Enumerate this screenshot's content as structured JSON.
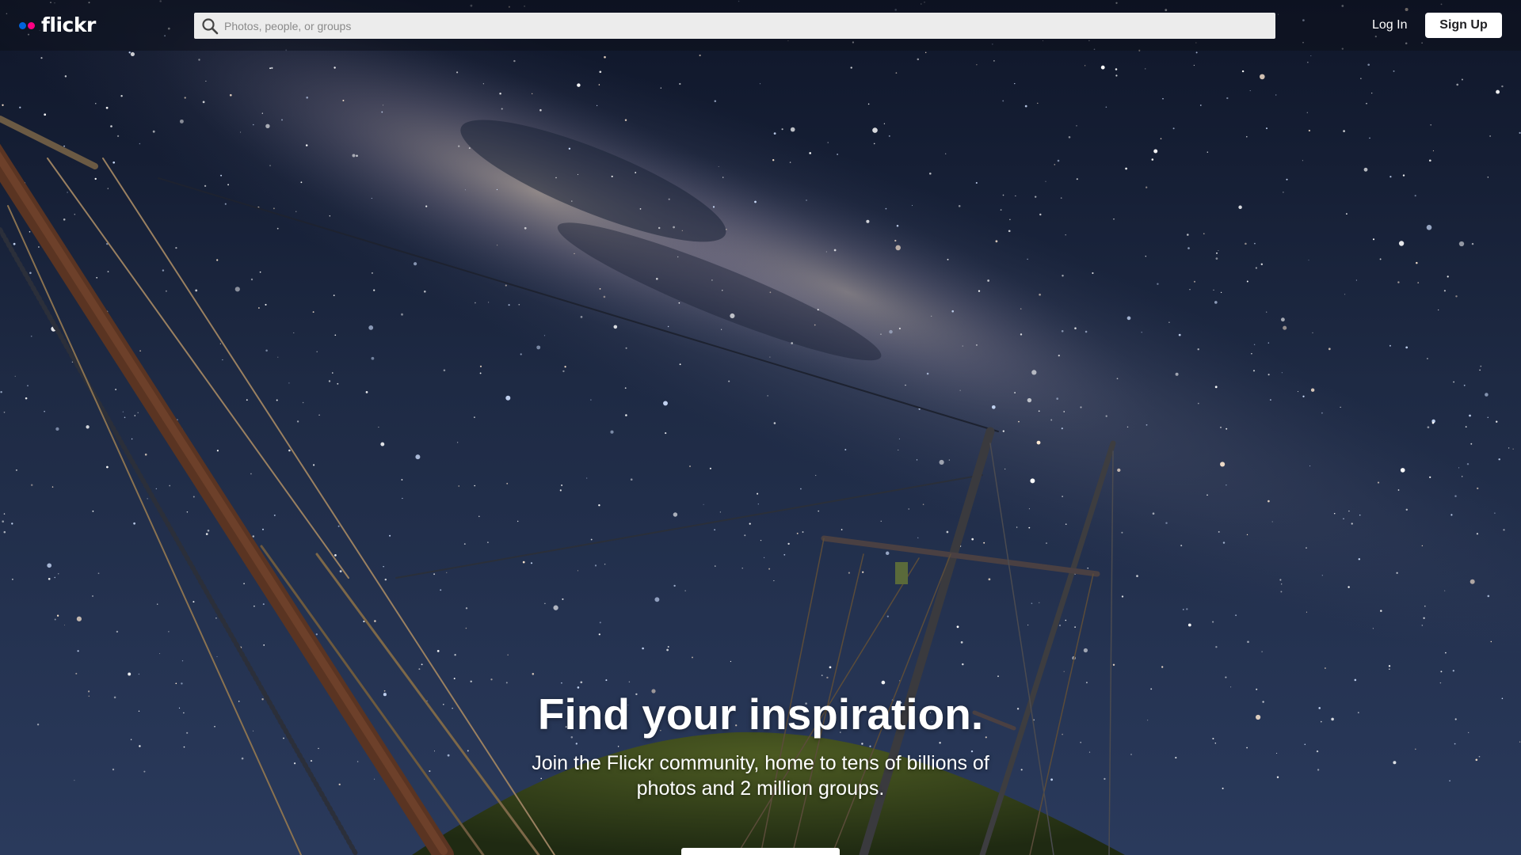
{
  "header": {
    "logo_text": "flickr",
    "logo_dot_colors": [
      "#0063dc",
      "#ff0084"
    ],
    "search_placeholder": "Photos, people, or groups",
    "login_label": "Log In",
    "signup_label": "Sign Up",
    "search_icon": "search-icon"
  },
  "hero": {
    "title": "Find your inspiration.",
    "subtitle": "Join the Flickr community, home to tens of billions of photos and 2 million groups.",
    "cta_label": ""
  },
  "colors": {
    "sky_top": "#0d1528",
    "sky_mid": "#243350",
    "milky_way": "#b8a79a",
    "hill": "#3a4a1e",
    "button_bg": "#ffffff"
  }
}
